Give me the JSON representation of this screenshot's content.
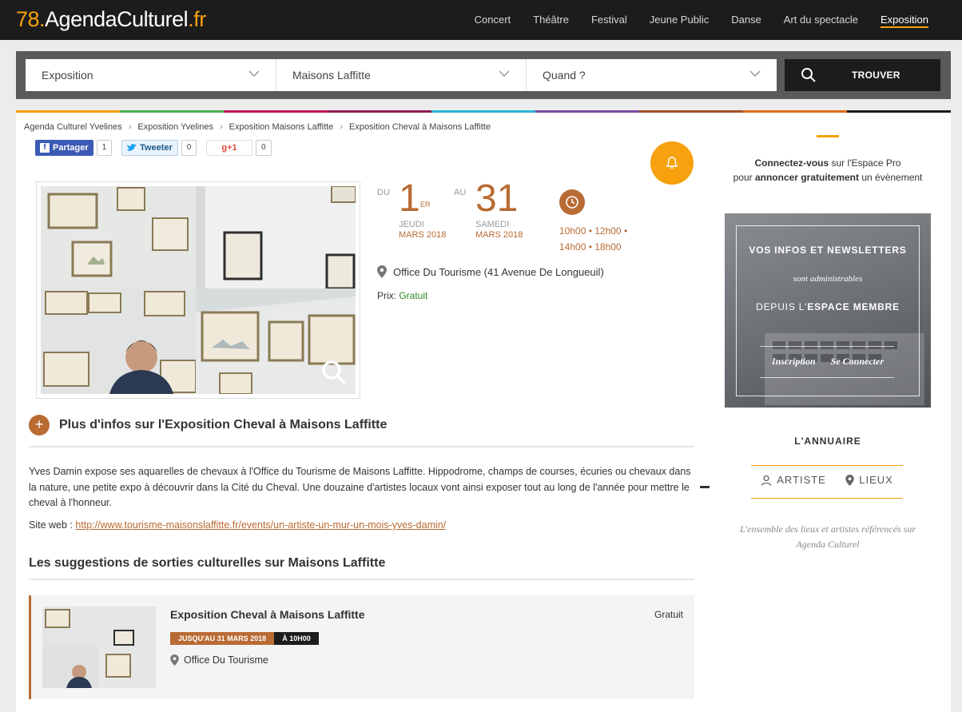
{
  "header": {
    "logo": {
      "num": "78.",
      "name_a": "Agenda",
      "name_b": "Culturel",
      "tld": ".fr"
    },
    "nav": [
      "Concert",
      "Théâtre",
      "Festival",
      "Jeune Public",
      "Danse",
      "Art du spectacle",
      "Exposition"
    ],
    "active_nav": "Exposition",
    "accent": "#f6a10d"
  },
  "search": {
    "category": "Exposition",
    "city": "Maisons Laffitte",
    "when": "Quand ?",
    "button": "TROUVER"
  },
  "strip_colors": [
    "#f6a10d",
    "#4caf50",
    "#c2185b",
    "#8e1b4f",
    "#29b6d6",
    "#7b4fa3",
    "#a0522d",
    "#e06a1a",
    "#1c1c1c"
  ],
  "breadcrumb": [
    "Agenda Culturel Yvelines",
    "Exposition Yvelines",
    "Exposition Maisons Laffitte",
    "Exposition Cheval à Maisons Laffitte"
  ],
  "share": {
    "facebook": {
      "label": "Partager",
      "count": "1"
    },
    "twitter": {
      "label": "Tweeter",
      "count": "0"
    },
    "google": {
      "label": "g+1",
      "count": "0"
    }
  },
  "event": {
    "from_label": "DU",
    "from_day": "1",
    "from_sup": "ER",
    "from_weekday": "JEUDI",
    "from_month": "MARS 2018",
    "to_label": "AU",
    "to_day": "31",
    "to_weekday": "SAMEDI",
    "to_month": "MARS 2018",
    "hours_line1": "10h00 • 12h00 •",
    "hours_line2": "14h00 • 18h00",
    "place": "Office Du Tourisme (41 Avenue De Longueuil)",
    "price_label": "Prix:",
    "price_value": "Gratuit"
  },
  "more": {
    "title": "Plus d'infos sur l'Exposition Cheval à Maisons Laffitte",
    "plus": "+",
    "description": "Yves Damin expose ses aquarelles de chevaux à l'Office du Tourisme de Maisons Laffitte. Hippodrome, champs de courses, écuries ou chevaux dans la nature, une petite expo à découvrir dans la Cité du Cheval. Une douzaine d'artistes locaux vont ainsi exposer tout au long de l'année pour mettre le cheval à l'honneur.",
    "site_label": "Site web :",
    "site_url": "http://www.tourisme-maisonslaffitte.fr/events/un-artiste-un-mur-un-mois-yves-damin/"
  },
  "suggestions": {
    "title": "Les suggestions de sorties culturelles sur Maisons Laffitte",
    "items": [
      {
        "title": "Exposition Cheval à Maisons Laffitte",
        "price": "Gratuit",
        "date_tag": "JUSQU'AU 31 MARS 2018",
        "time_tag": "À 10H00",
        "place": "Office Du Tourisme"
      }
    ]
  },
  "sidebar": {
    "connect_b1": "Connectez-vous",
    "connect_t1": " sur l'Espace Pro",
    "connect_t2": "pour ",
    "connect_b2": "annoncer gratuitement",
    "connect_t3": " un évènement",
    "promo_l1": "VOS INFOS ET NEWSLETTERS",
    "promo_l2": "sont administrables",
    "promo_l3a": "DEPUIS L'",
    "promo_l3b": "ESPACE MEMBRE",
    "promo_link1": "Inscription",
    "promo_link2": "Se Connecter",
    "annuaire": "L'ANNUAIRE",
    "artiste": "ARTISTE",
    "lieux": "LIEUX",
    "note": "L'ensemble des lieux et artistes référencés sur Agenda Culturel"
  }
}
